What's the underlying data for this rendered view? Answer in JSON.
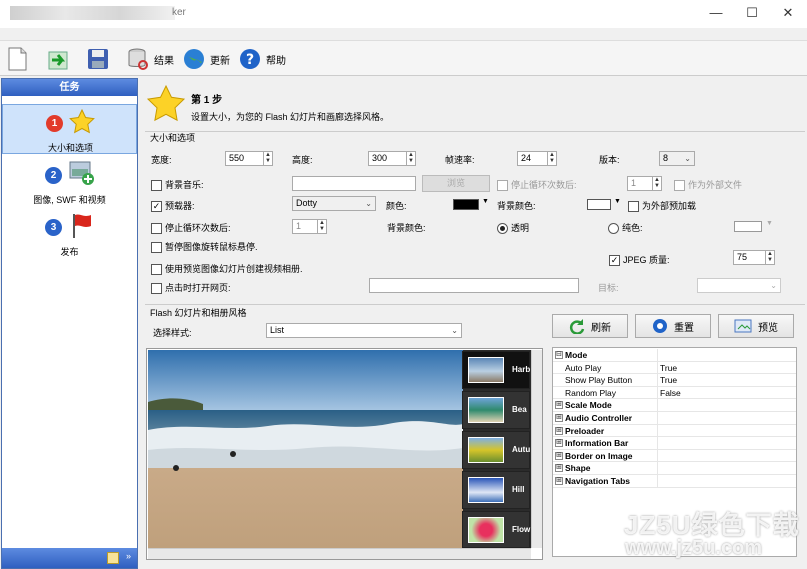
{
  "window": {
    "title": "ker",
    "minimize": "—",
    "maximize": "☐",
    "close": "✕"
  },
  "toolbar": {
    "result": "结果",
    "update": "更新",
    "help": "帮助"
  },
  "tasks": {
    "header": "任务",
    "items": [
      {
        "num": "1",
        "label": "大小和选项"
      },
      {
        "num": "2",
        "label": "图像, SWF 和视频"
      },
      {
        "num": "3",
        "label": "发布"
      }
    ]
  },
  "step": {
    "title": "第 1 步",
    "desc": "设置大小，为您的 Flash 幻灯片和画廊选择风格。"
  },
  "size": {
    "group": "大小和选项",
    "width_label": "宽度:",
    "width": "550",
    "height_label": "高度:",
    "height": "300",
    "fps_label": "帧速率:",
    "fps": "24",
    "version_label": "版本:",
    "version": "8",
    "bgmusic_label": "背景音乐:",
    "browse": "浏览",
    "stoploop_label": "停止循环次数后:",
    "stoploop_val": "1",
    "external_file": "作为外部文件",
    "preloader_label": "预载器:",
    "preloader": "Dotty",
    "color_label": "颜色:",
    "bgcolor_label": "背景颜色:",
    "preload_external": "为外部预加载",
    "stoploop2_label": "停止循环次数后:",
    "stoploop2_val": "1",
    "bgcolor2_label": "背景颜色:",
    "transparent": "透明",
    "solid": "纯色:",
    "pause_hover": "暂停图像旋转鼠标悬停.",
    "jpeg_label": "JPEG 质量:",
    "jpeg": "75",
    "use_preview": "使用预览图像幻灯片创建视频相册.",
    "open_url": "点击时打开网页:",
    "target_label": "目标:"
  },
  "style": {
    "group": "Flash 幻灯片和相册风格",
    "select_label": "选择样式:",
    "select_value": "List"
  },
  "thumbs": [
    "Harb",
    "Bea",
    "Autu",
    "Hill",
    "Flow"
  ],
  "actions": {
    "refresh": "刷新",
    "reset": "重置",
    "preview": "预览"
  },
  "props": [
    {
      "exp": "⊟",
      "k": "Mode",
      "v": "",
      "bold": true
    },
    {
      "exp": "",
      "k": "Auto Play",
      "v": "True",
      "bold": false
    },
    {
      "exp": "",
      "k": "Show Play Button",
      "v": "True",
      "bold": false
    },
    {
      "exp": "",
      "k": "Random Play",
      "v": "False",
      "bold": false
    },
    {
      "exp": "⊞",
      "k": "Scale Mode",
      "v": "",
      "bold": true
    },
    {
      "exp": "⊞",
      "k": "Audio Controller",
      "v": "",
      "bold": true
    },
    {
      "exp": "⊞",
      "k": "Preloader",
      "v": "",
      "bold": true
    },
    {
      "exp": "⊞",
      "k": "Information Bar",
      "v": "",
      "bold": true
    },
    {
      "exp": "⊞",
      "k": "Border on Image",
      "v": "",
      "bold": true
    },
    {
      "exp": "⊞",
      "k": "Shape",
      "v": "",
      "bold": true
    },
    {
      "exp": "⊞",
      "k": "Navigation Tabs",
      "v": "",
      "bold": true
    }
  ],
  "watermark": {
    "line1": "JZ5U绿色下载",
    "line2": "www.jz5u.com"
  }
}
